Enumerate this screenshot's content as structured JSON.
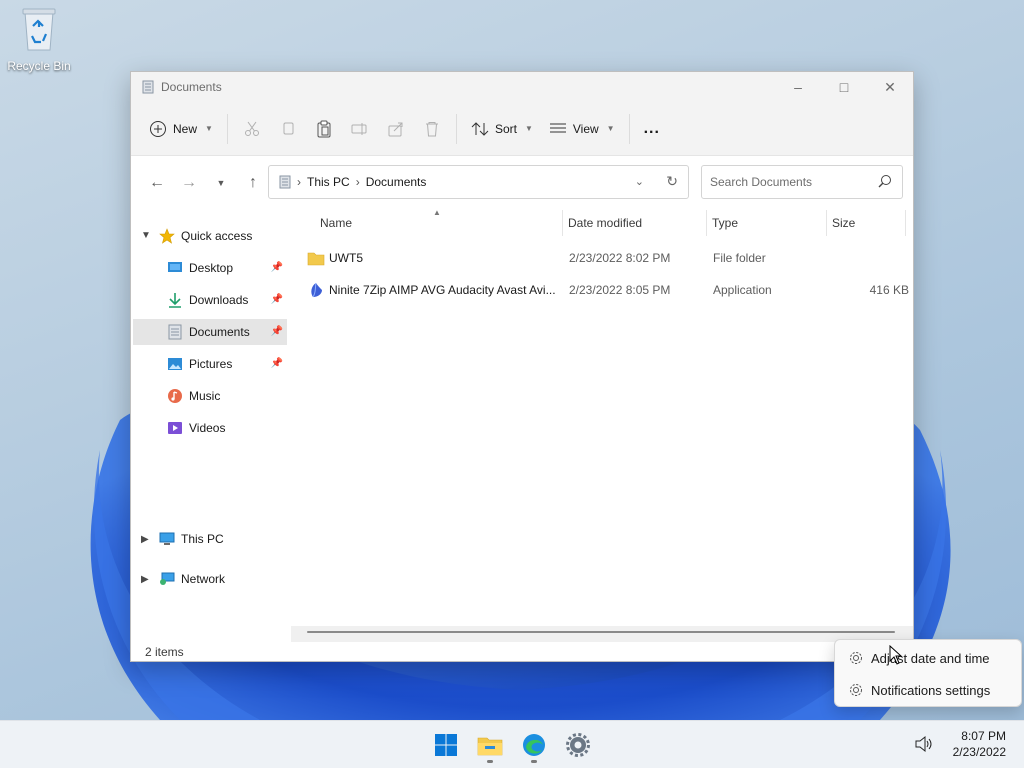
{
  "desktop": {
    "recycle_bin_label": "Recycle Bin"
  },
  "window": {
    "title": "Documents",
    "controls": [
      "minimize-icon",
      "maximize-icon",
      "close-icon"
    ]
  },
  "toolbar": {
    "new_label": "New",
    "sort_label": "Sort",
    "view_label": "View",
    "more_label": "..."
  },
  "address": {
    "segments": [
      "This PC",
      "Documents"
    ]
  },
  "search": {
    "placeholder": "Search Documents"
  },
  "sidebar": {
    "quick_access": "Quick access",
    "items": [
      {
        "label": "Desktop",
        "icon": "desktop-icon",
        "pinned": true
      },
      {
        "label": "Downloads",
        "icon": "downloads-icon",
        "pinned": true
      },
      {
        "label": "Documents",
        "icon": "documents-icon",
        "pinned": true,
        "selected": true
      },
      {
        "label": "Pictures",
        "icon": "pictures-icon",
        "pinned": true
      },
      {
        "label": "Music",
        "icon": "music-icon",
        "pinned": false
      },
      {
        "label": "Videos",
        "icon": "videos-icon",
        "pinned": false
      }
    ],
    "this_pc": "This PC",
    "network": "Network"
  },
  "columns": {
    "name": "Name",
    "date": "Date modified",
    "type": "Type",
    "size": "Size"
  },
  "files": [
    {
      "name": "UWT5",
      "date": "2/23/2022 8:02 PM",
      "type": "File folder",
      "size": ""
    },
    {
      "name": "Ninite 7Zip AIMP AVG Audacity Avast Avi...",
      "date": "2/23/2022 8:05 PM",
      "type": "Application",
      "size": "416 KB"
    }
  ],
  "status": {
    "count": "2 items"
  },
  "context_menu": {
    "items": [
      "Adjust date and time",
      "Notifications settings"
    ]
  },
  "taskbar": {
    "apps": [
      "start-icon",
      "file-explorer-icon",
      "edge-icon",
      "settings-icon"
    ],
    "time": "8:07 PM",
    "date": "2/23/2022"
  },
  "colors": {
    "accent": "#0067c0",
    "selected_bg": "#e5e5e5",
    "folder": "#f2c94c"
  }
}
